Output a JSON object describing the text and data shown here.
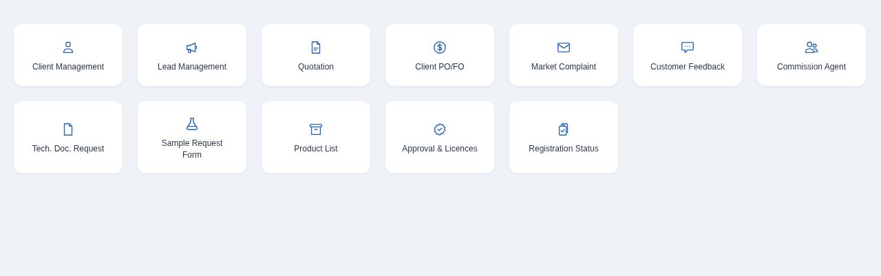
{
  "modules": [
    {
      "label": "Client Management",
      "kind": "user"
    },
    {
      "label": "Lead Management",
      "kind": "megaphone"
    },
    {
      "label": "Quotation",
      "kind": "document-lines"
    },
    {
      "label": "Client PO/FO",
      "kind": "dollar"
    },
    {
      "label": "Market Complaint",
      "kind": "envelope"
    },
    {
      "label": "Customer Feedback",
      "kind": "chat"
    },
    {
      "label": "Commission Agent",
      "kind": "users"
    },
    {
      "label": "Tech. Doc. Request",
      "kind": "document"
    },
    {
      "label": "Sample Request Form",
      "kind": "flask"
    },
    {
      "label": "Product List",
      "kind": "archive"
    },
    {
      "label": "Approval & Licences",
      "kind": "badge-check"
    },
    {
      "label": "Registration Status",
      "kind": "clipboards"
    }
  ]
}
